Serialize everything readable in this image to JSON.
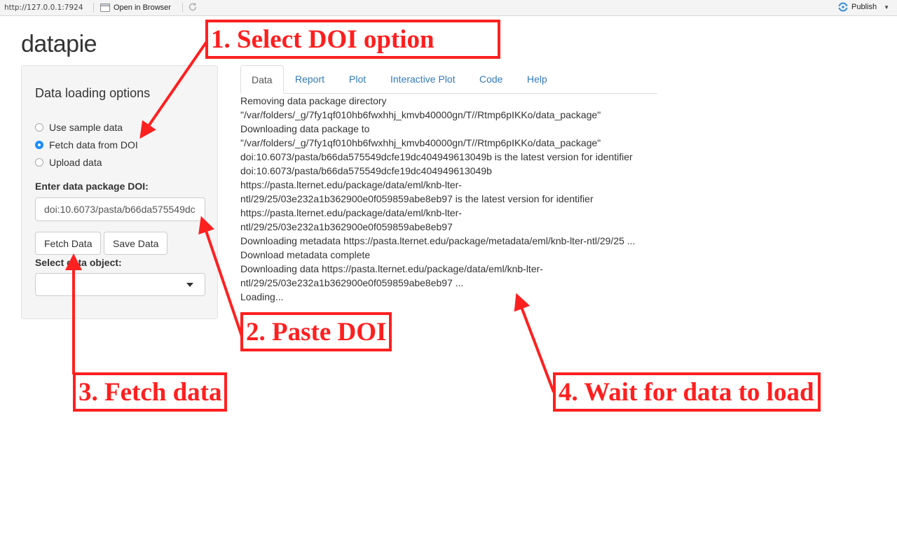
{
  "toolbar": {
    "url": "http://127.0.0.1:7924",
    "open_in_browser": "Open in Browser",
    "publish": "Publish"
  },
  "app": {
    "title": "datapie"
  },
  "sidebar": {
    "heading": "Data loading options",
    "radios": [
      {
        "label": "Use sample data",
        "checked": false
      },
      {
        "label": "Fetch data from DOI",
        "checked": true
      },
      {
        "label": "Upload data",
        "checked": false
      }
    ],
    "doi_label": "Enter data package DOI:",
    "doi_value": "doi:10.6073/pasta/b66da575549dc",
    "fetch_button": "Fetch Data",
    "save_button": "Save Data",
    "select_label": "Select data object:",
    "select_value": ""
  },
  "tabs": [
    {
      "label": "Data",
      "active": true
    },
    {
      "label": "Report",
      "active": false
    },
    {
      "label": "Plot",
      "active": false
    },
    {
      "label": "Interactive Plot",
      "active": false
    },
    {
      "label": "Code",
      "active": false
    },
    {
      "label": "Help",
      "active": false
    }
  ],
  "log": [
    "Removing data package directory",
    "\"/var/folders/_g/7fy1qf010hb6fwxhhj_kmvb40000gn/T//Rtmp6pIKKo/data_package\"",
    "Downloading data package to",
    "\"/var/folders/_g/7fy1qf010hb6fwxhhj_kmvb40000gn/T//Rtmp6pIKKo/data_package\"",
    "doi:10.6073/pasta/b66da575549dcfe19dc404949613049b is the latest version for identifier",
    "doi:10.6073/pasta/b66da575549dcfe19dc404949613049b",
    "https://pasta.lternet.edu/package/data/eml/knb-lter-",
    "ntl/29/25/03e232a1b362900e0f059859abe8eb97 is the latest version for identifier",
    "https://pasta.lternet.edu/package/data/eml/knb-lter-",
    "ntl/29/25/03e232a1b362900e0f059859abe8eb97",
    "Downloading metadata https://pasta.lternet.edu/package/metadata/eml/knb-lter-ntl/29/25 ...",
    "Download metadata complete",
    "Downloading data https://pasta.lternet.edu/package/data/eml/knb-lter-",
    "ntl/29/25/03e232a1b362900e0f059859abe8eb97 ...",
    "Loading..."
  ],
  "annotations": {
    "step1": "1. Select DOI option",
    "step2": "2. Paste DOI",
    "step3": "3. Fetch data",
    "step4": "4. Wait for data to load",
    "color": "#ff1f1f"
  }
}
